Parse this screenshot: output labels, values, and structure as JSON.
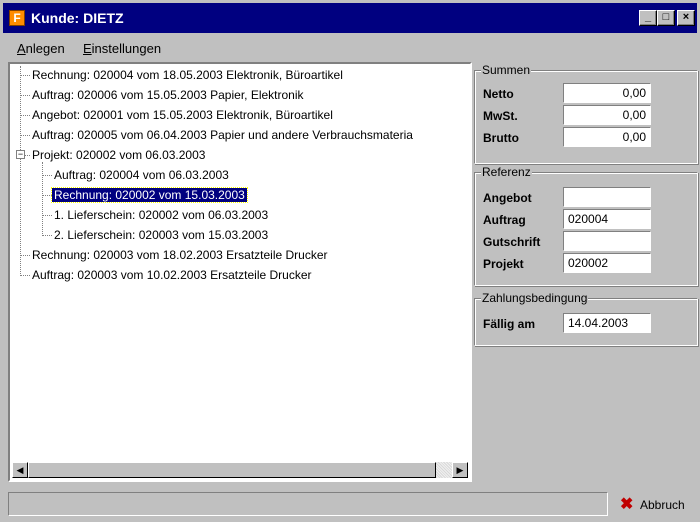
{
  "window": {
    "title": "Kunde: DIETZ",
    "app_icon_glyph": "F",
    "controls": {
      "minimize": "_",
      "maximize": "□",
      "close": "×"
    }
  },
  "menu": [
    {
      "label": "Anlegen",
      "accel": "A",
      "rest": "nlegen"
    },
    {
      "label": "Einstellungen",
      "accel": "E",
      "rest": "instellungen"
    }
  ],
  "tree": {
    "items": [
      {
        "label": "Rechnung: 020004 vom 18.05.2003 Elektronik, Büroartikel",
        "level": 0
      },
      {
        "label": "Auftrag: 020006 vom 15.05.2003 Papier, Elektronik",
        "level": 0
      },
      {
        "label": "Angebot: 020001 vom 15.05.2003 Elektronik, Büroartikel",
        "level": 0
      },
      {
        "label": "Auftrag: 020005 vom 06.04.2003 Papier und andere Verbrauchsmateria",
        "level": 0
      },
      {
        "label": "Projekt: 020002 vom 06.03.2003",
        "level": 0,
        "expanded": true
      },
      {
        "label": "Auftrag: 020004 vom 06.03.2003",
        "level": 1
      },
      {
        "label": "Rechnung: 020002 vom 15.03.2003",
        "level": 1,
        "selected": true
      },
      {
        "label": "1. Lieferschein: 020002 vom 06.03.2003",
        "level": 1
      },
      {
        "label": "2. Lieferschein: 020003 vom 15.03.2003",
        "level": 1
      },
      {
        "label": "Rechnung: 020003 vom 18.02.2003 Ersatzteile Drucker",
        "level": 0
      },
      {
        "label": "Auftrag: 020003 vom 10.02.2003 Ersatzteile Drucker",
        "level": 0
      }
    ],
    "expander_glyph": "−"
  },
  "summen": {
    "title": "Summen",
    "netto_label": "Netto",
    "netto_value": "0,00",
    "mwst_label": "MwSt.",
    "mwst_value": "0,00",
    "brutto_label": "Brutto",
    "brutto_value": "0,00"
  },
  "referenz": {
    "title": "Referenz",
    "angebot_label": "Angebot",
    "angebot_value": "",
    "auftrag_label": "Auftrag",
    "auftrag_value": "020004",
    "gutschrift_label": "Gutschrift",
    "gutschrift_value": "",
    "projekt_label": "Projekt",
    "projekt_value": "020002"
  },
  "zahlung": {
    "title": "Zahlungsbedingung",
    "faellig_label": "Fällig am",
    "faellig_value": "14.04.2003"
  },
  "footer": {
    "status_text": "",
    "abbruch_label": "Abbruch",
    "abbruch_icon": "✖"
  },
  "colors": {
    "titlebar": "#000080",
    "selection": "#000080",
    "window_bg": "#c0c0c0",
    "abbruch_icon": "#c00000"
  }
}
